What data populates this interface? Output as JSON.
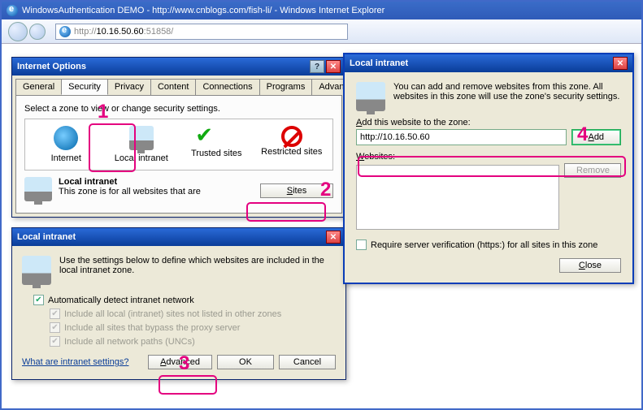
{
  "browser": {
    "title": "WindowsAuthentication DEMO - http://www.cnblogs.com/fish-li/ - Windows Internet Explorer",
    "url_prefix": "http://",
    "url_host": "10.16.50.60",
    "url_port": ":51858/"
  },
  "iopt": {
    "title": "Internet Options",
    "tabs": [
      "General",
      "Security",
      "Privacy",
      "Content",
      "Connections",
      "Programs",
      "Advanced"
    ],
    "active_tab": "Security",
    "select_zone": "Select a zone to view or change security settings.",
    "zones": {
      "internet": "Internet",
      "local": "Local intranet",
      "trusted": "Trusted sites",
      "restricted": "Restricted sites"
    },
    "zone_detail_title": "Local intranet",
    "zone_detail_desc": "This zone is for all websites that are",
    "sites_btn": "Sites"
  },
  "li_sub": {
    "title": "Local intranet",
    "info": "Use the settings below to define which websites are included in the local intranet zone.",
    "auto": "Automatically detect intranet network",
    "c1": "Include all local (intranet) sites not listed in other zones",
    "c2": "Include all sites that bypass the proxy server",
    "c3": "Include all network paths (UNCs)",
    "link": "What are intranet settings?",
    "advanced": "Advanced",
    "ok": "OK",
    "cancel": "Cancel"
  },
  "li_add": {
    "title": "Local intranet",
    "info": "You can add and remove websites from this zone. All websites in this zone will use the zone's security settings.",
    "add_label": "Add this website to the zone:",
    "url_value": "http://10.16.50.60",
    "add": "Add",
    "websites": "Websites:",
    "remove": "Remove",
    "require": "Require server verification (https:) for all sites in this zone",
    "close": "Close"
  },
  "anno": {
    "n1": "1",
    "n2": "2",
    "n3": "3",
    "n4": "4"
  }
}
